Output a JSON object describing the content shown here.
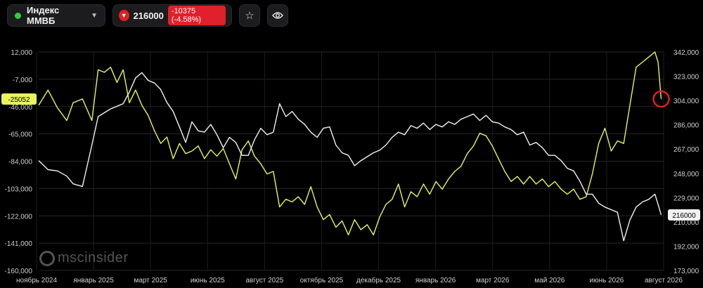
{
  "toolbar": {
    "symbol": "Индекс ММВБ",
    "price": "216000",
    "change": "-10375 (-4.58%)",
    "star_icon": "star-icon",
    "eye_icon": "eye-icon"
  },
  "watermark": {
    "text": "mscinsider"
  },
  "chart_data": {
    "type": "line",
    "left_axis": {
      "ticks": [
        "12,000",
        "-7,000",
        "-46,000",
        "-65,000",
        "-84,000",
        "-103,000",
        "-122,000",
        "-141,000",
        "-160,000"
      ],
      "range": [
        -160000,
        12000
      ]
    },
    "right_axis": {
      "ticks": [
        "342,000",
        "323,000",
        "304,000",
        "286,000",
        "267,000",
        "248,000",
        "229,000",
        "210,000",
        "192,000",
        "173,000"
      ],
      "range": [
        173000,
        342000
      ]
    },
    "x_ticks": [
      "ноябрь 2024",
      "январь 2025",
      "март 2025",
      "июнь 2025",
      "август 2025",
      "октябрь 2025",
      "декабрь 2025",
      "январь 2026",
      "март 2026",
      "май 2026",
      "июнь 2026",
      "август 2026"
    ],
    "x_range": [
      0,
      100
    ],
    "last_labels": {
      "left": "-25052",
      "right": "216000"
    },
    "series": [
      {
        "color": "#e8f55a",
        "axis": "left",
        "points": [
          [
            0,
            -30000
          ],
          [
            1.5,
            -18000
          ],
          [
            3,
            -32000
          ],
          [
            4.5,
            -42000
          ],
          [
            5.5,
            -28000
          ],
          [
            7,
            -25000
          ],
          [
            8.5,
            -42000
          ],
          [
            9.5,
            -2000
          ],
          [
            10.5,
            -4000
          ],
          [
            11.5,
            0
          ],
          [
            12.5,
            -12000
          ],
          [
            13.5,
            -2000
          ],
          [
            14.5,
            -28000
          ],
          [
            15.5,
            -18000
          ],
          [
            16.5,
            -30000
          ],
          [
            17.5,
            -38000
          ],
          [
            18.5,
            -50000
          ],
          [
            19.5,
            -60000
          ],
          [
            20.5,
            -55000
          ],
          [
            21.5,
            -72000
          ],
          [
            22.5,
            -60000
          ],
          [
            23.5,
            -68000
          ],
          [
            24.5,
            -66000
          ],
          [
            25.5,
            -62000
          ],
          [
            26.5,
            -72000
          ],
          [
            27.5,
            -65000
          ],
          [
            28.5,
            -70000
          ],
          [
            29.5,
            -64000
          ],
          [
            30.5,
            -76000
          ],
          [
            31.5,
            -88000
          ],
          [
            32.5,
            -65000
          ],
          [
            33.5,
            -58000
          ],
          [
            34.5,
            -70000
          ],
          [
            35.5,
            -76000
          ],
          [
            36.5,
            -84000
          ],
          [
            37.5,
            -82000
          ],
          [
            38.5,
            -110000
          ],
          [
            39.5,
            -104000
          ],
          [
            40.5,
            -106000
          ],
          [
            41.5,
            -102000
          ],
          [
            42.5,
            -108000
          ],
          [
            43.5,
            -94000
          ],
          [
            44.5,
            -110000
          ],
          [
            45.5,
            -120000
          ],
          [
            46.5,
            -116000
          ],
          [
            47.5,
            -126000
          ],
          [
            48.5,
            -121000
          ],
          [
            49.5,
            -132000
          ],
          [
            50.5,
            -120000
          ],
          [
            51.5,
            -128000
          ],
          [
            52.5,
            -124000
          ],
          [
            53.5,
            -132000
          ],
          [
            54.5,
            -118000
          ],
          [
            55.5,
            -108000
          ],
          [
            56.5,
            -104000
          ],
          [
            57.5,
            -92000
          ],
          [
            58.5,
            -110000
          ],
          [
            59.5,
            -98000
          ],
          [
            60.5,
            -102000
          ],
          [
            61.5,
            -92000
          ],
          [
            62.5,
            -100000
          ],
          [
            63.5,
            -90000
          ],
          [
            64.5,
            -96000
          ],
          [
            65.5,
            -88000
          ],
          [
            66.5,
            -82000
          ],
          [
            67.5,
            -78000
          ],
          [
            68.5,
            -68000
          ],
          [
            69.5,
            -62000
          ],
          [
            70.5,
            -52000
          ],
          [
            71.5,
            -54000
          ],
          [
            72.5,
            -62000
          ],
          [
            73.5,
            -72000
          ],
          [
            74.5,
            -82000
          ],
          [
            75.5,
            -90000
          ],
          [
            76.5,
            -86000
          ],
          [
            77.5,
            -92000
          ],
          [
            78.5,
            -86000
          ],
          [
            79.5,
            -92000
          ],
          [
            80.5,
            -88000
          ],
          [
            81.5,
            -94000
          ],
          [
            82.5,
            -90000
          ],
          [
            83.5,
            -96000
          ],
          [
            84.5,
            -100000
          ],
          [
            85.5,
            -96000
          ],
          [
            86.5,
            -104000
          ],
          [
            87.5,
            -102000
          ],
          [
            88.5,
            -84000
          ],
          [
            89.5,
            -60000
          ],
          [
            90.5,
            -48000
          ],
          [
            91.5,
            -66000
          ],
          [
            92.5,
            -58000
          ],
          [
            93.5,
            -60000
          ],
          [
            94.5,
            -30000
          ],
          [
            95.5,
            0
          ],
          [
            96.5,
            4000
          ],
          [
            97.5,
            8000
          ],
          [
            98.5,
            12000
          ],
          [
            99,
            4000
          ],
          [
            99.5,
            -25052
          ]
        ]
      },
      {
        "color": "#f2f2f2",
        "axis": "right",
        "points": [
          [
            0,
            258000
          ],
          [
            1.5,
            251000
          ],
          [
            3,
            250000
          ],
          [
            4.5,
            246000
          ],
          [
            5.5,
            240000
          ],
          [
            7,
            238000
          ],
          [
            8.5,
            270000
          ],
          [
            9.5,
            292000
          ],
          [
            10.5,
            295000
          ],
          [
            11.5,
            298000
          ],
          [
            12.5,
            300000
          ],
          [
            13.5,
            302000
          ],
          [
            14.5,
            311000
          ],
          [
            15.5,
            322000
          ],
          [
            16.5,
            326000
          ],
          [
            17.5,
            320000
          ],
          [
            18.5,
            318000
          ],
          [
            19.5,
            313000
          ],
          [
            20.5,
            303000
          ],
          [
            21.5,
            296000
          ],
          [
            22.5,
            284000
          ],
          [
            23.5,
            272000
          ],
          [
            24.5,
            288000
          ],
          [
            25.5,
            281000
          ],
          [
            26.5,
            280000
          ],
          [
            27.5,
            286000
          ],
          [
            28.5,
            278000
          ],
          [
            29.5,
            268000
          ],
          [
            30.5,
            276000
          ],
          [
            31.5,
            272000
          ],
          [
            32.5,
            262000
          ],
          [
            33.5,
            262000
          ],
          [
            34.5,
            274000
          ],
          [
            35.5,
            283000
          ],
          [
            36.5,
            278000
          ],
          [
            37.5,
            280000
          ],
          [
            38.5,
            302000
          ],
          [
            39.5,
            292000
          ],
          [
            40.5,
            296000
          ],
          [
            41.5,
            290000
          ],
          [
            42.5,
            286000
          ],
          [
            43.5,
            280000
          ],
          [
            44.5,
            276000
          ],
          [
            45.5,
            283000
          ],
          [
            46.5,
            284000
          ],
          [
            47.5,
            270000
          ],
          [
            48.5,
            264000
          ],
          [
            49.5,
            262000
          ],
          [
            50.5,
            254000
          ],
          [
            51.5,
            258000
          ],
          [
            52.5,
            261000
          ],
          [
            53.5,
            264000
          ],
          [
            54.5,
            266000
          ],
          [
            55.5,
            270000
          ],
          [
            56.5,
            276000
          ],
          [
            57.5,
            280000
          ],
          [
            58.5,
            278000
          ],
          [
            59.5,
            285000
          ],
          [
            60.5,
            283000
          ],
          [
            61.5,
            287000
          ],
          [
            62.5,
            282000
          ],
          [
            63.5,
            286000
          ],
          [
            64.5,
            284000
          ],
          [
            65.5,
            288000
          ],
          [
            66.5,
            286000
          ],
          [
            67.5,
            290000
          ],
          [
            68.5,
            292000
          ],
          [
            69.5,
            294000
          ],
          [
            70.5,
            289000
          ],
          [
            71.5,
            293000
          ],
          [
            72.5,
            288000
          ],
          [
            73.5,
            287000
          ],
          [
            74.5,
            284000
          ],
          [
            75.5,
            282000
          ],
          [
            76.5,
            278000
          ],
          [
            77.5,
            280000
          ],
          [
            78.5,
            270000
          ],
          [
            79.5,
            272000
          ],
          [
            80.5,
            268000
          ],
          [
            81.5,
            262000
          ],
          [
            82.5,
            262000
          ],
          [
            83.5,
            258000
          ],
          [
            84.5,
            252000
          ],
          [
            85.5,
            250000
          ],
          [
            86.5,
            242000
          ],
          [
            87.5,
            232000
          ],
          [
            88.5,
            232000
          ],
          [
            89.5,
            225000
          ],
          [
            90.5,
            222000
          ],
          [
            91.5,
            220000
          ],
          [
            92.5,
            218000
          ],
          [
            93.5,
            196000
          ],
          [
            94.5,
            212000
          ],
          [
            95.5,
            222000
          ],
          [
            96.5,
            226000
          ],
          [
            97.5,
            228000
          ],
          [
            98.5,
            232000
          ],
          [
            99,
            224000
          ],
          [
            99.5,
            216000
          ]
        ]
      }
    ],
    "marker": {
      "color": "#e02020",
      "x": 99.5,
      "axis": "left",
      "value": -25052
    }
  }
}
